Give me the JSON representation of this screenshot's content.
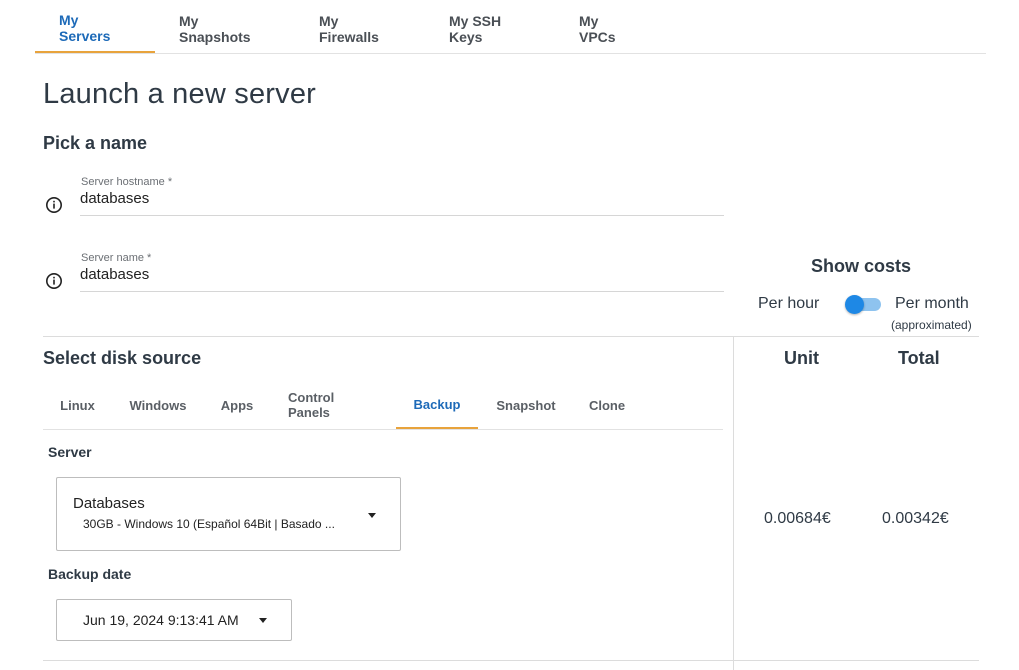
{
  "top_tabs": [
    "My Servers",
    "My Snapshots",
    "My Firewalls",
    "My SSH Keys",
    "My VPCs"
  ],
  "page_title": "Launch a new server",
  "name_section": {
    "title": "Pick a name",
    "hostname": {
      "label": "Server hostname *",
      "value": "databases"
    },
    "server_name": {
      "label": "Server name *",
      "value": "databases"
    }
  },
  "costs": {
    "title": "Show costs",
    "per_hour": "Per hour",
    "per_month": "Per month",
    "approx": "(approximated)",
    "unit_header": "Unit",
    "total_header": "Total",
    "unit_value": "0.00684€",
    "total_value": "0.00342€"
  },
  "disk_section": {
    "title": "Select disk source",
    "tabs": [
      "Linux",
      "Windows",
      "Apps",
      "Control Panels",
      "Backup",
      "Snapshot",
      "Clone"
    ],
    "active_tab": "Backup",
    "server_label": "Server",
    "server_select": {
      "name": "Databases",
      "detail": "30GB - Windows 10 (Español 64Bit | Basado ..."
    },
    "backup_date_label": "Backup date",
    "backup_date_value": "Jun 19, 2024 9:13:41 AM"
  },
  "colors": {
    "accent_blue": "#1d6ab8",
    "tab_underline": "#e8a33c",
    "toggle_blue": "#1e88e5"
  }
}
